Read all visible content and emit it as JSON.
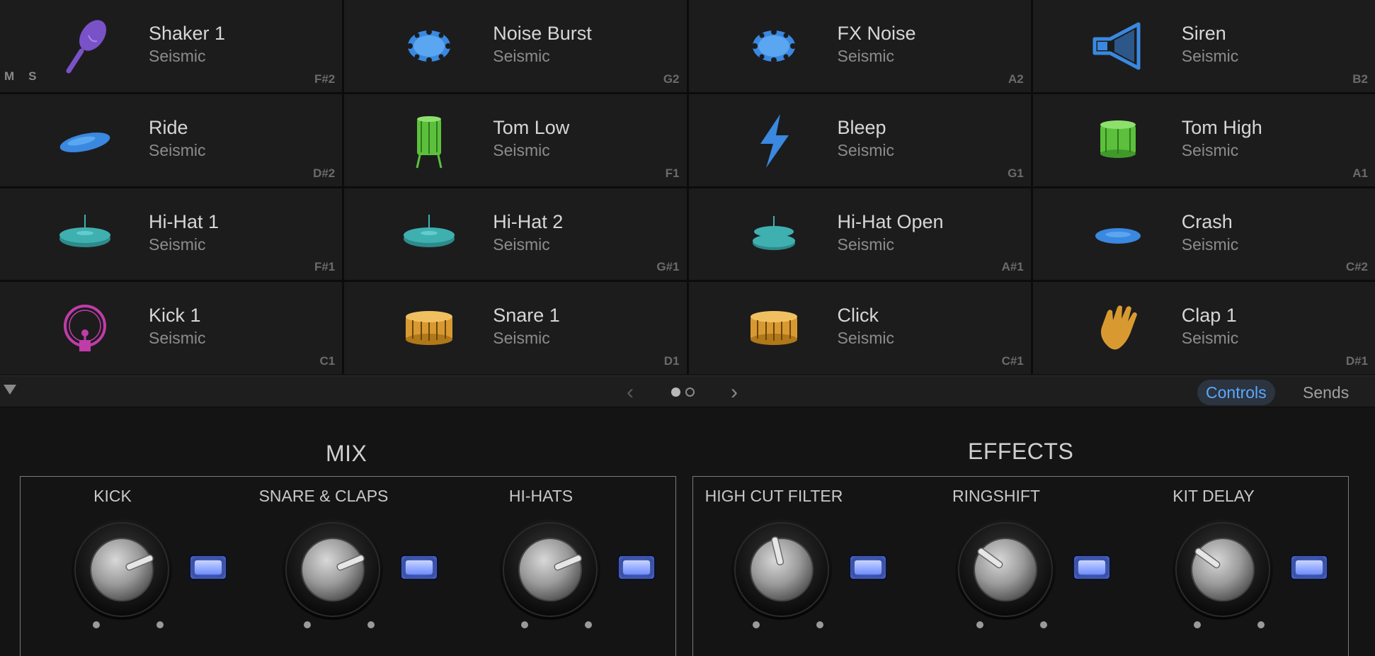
{
  "pads": [
    {
      "name": "Shaker 1",
      "library": "Seismic",
      "note": "F#2",
      "icon": "shaker-icon",
      "color": "#7a52c8",
      "show_ms": true
    },
    {
      "name": "Noise Burst",
      "library": "Seismic",
      "note": "G2",
      "icon": "noise-icon",
      "color": "#3a88e0"
    },
    {
      "name": "FX Noise",
      "library": "Seismic",
      "note": "A2",
      "icon": "noise-icon",
      "color": "#3a88e0"
    },
    {
      "name": "Siren",
      "library": "Seismic",
      "note": "B2",
      "icon": "siren-icon",
      "color": "#3a88e0"
    },
    {
      "name": "Ride",
      "library": "Seismic",
      "note": "D#2",
      "icon": "cymbal-icon",
      "color": "#3a88e0"
    },
    {
      "name": "Tom Low",
      "library": "Seismic",
      "note": "F1",
      "icon": "floor-tom-icon",
      "color": "#5cc03c"
    },
    {
      "name": "Bleep",
      "library": "Seismic",
      "note": "G1",
      "icon": "lightning-icon",
      "color": "#3a88e0"
    },
    {
      "name": "Tom High",
      "library": "Seismic",
      "note": "A1",
      "icon": "tom-icon",
      "color": "#5cc03c"
    },
    {
      "name": "Hi-Hat 1",
      "library": "Seismic",
      "note": "F#1",
      "icon": "hihat-icon",
      "color": "#3fb0b0"
    },
    {
      "name": "Hi-Hat 2",
      "library": "Seismic",
      "note": "G#1",
      "icon": "hihat-icon",
      "color": "#3fb0b0"
    },
    {
      "name": "Hi-Hat Open",
      "library": "Seismic",
      "note": "A#1",
      "icon": "hihat-open-icon",
      "color": "#3fb0b0"
    },
    {
      "name": "Crash",
      "library": "Seismic",
      "note": "C#2",
      "icon": "crash-icon",
      "color": "#3a88e0"
    },
    {
      "name": "Kick 1",
      "library": "Seismic",
      "note": "C1",
      "icon": "kick-icon",
      "color": "#c03ca8"
    },
    {
      "name": "Snare 1",
      "library": "Seismic",
      "note": "D1",
      "icon": "snare-icon",
      "color": "#d89a30"
    },
    {
      "name": "Click",
      "library": "Seismic",
      "note": "C#1",
      "icon": "snare-icon",
      "color": "#d89a30"
    },
    {
      "name": "Clap 1",
      "library": "Seismic",
      "note": "D#1",
      "icon": "clap-icon",
      "color": "#d89a30"
    }
  ],
  "ms": {
    "mute": "M",
    "solo": "S"
  },
  "nav": {
    "prev": "‹",
    "next": "›",
    "tabs": {
      "controls": "Controls",
      "sends": "Sends"
    },
    "active_tab": "controls",
    "page": 1,
    "page_count": 2
  },
  "mix": {
    "title": "MIX",
    "knobs": [
      {
        "label": "KICK",
        "value": 0.75
      },
      {
        "label": "SNARE & CLAPS",
        "value": 0.75
      },
      {
        "label": "HI-HATS",
        "value": 0.75
      }
    ]
  },
  "effects": {
    "title": "EFFECTS",
    "knobs": [
      {
        "label": "HIGH CUT FILTER",
        "value": 0.45
      },
      {
        "label": "RINGSHIFT",
        "value": 0.3
      },
      {
        "label": "KIT DELAY",
        "value": 0.3
      }
    ]
  },
  "colors": {
    "accent": "#5aa9ff",
    "led": "#6f8cff"
  }
}
